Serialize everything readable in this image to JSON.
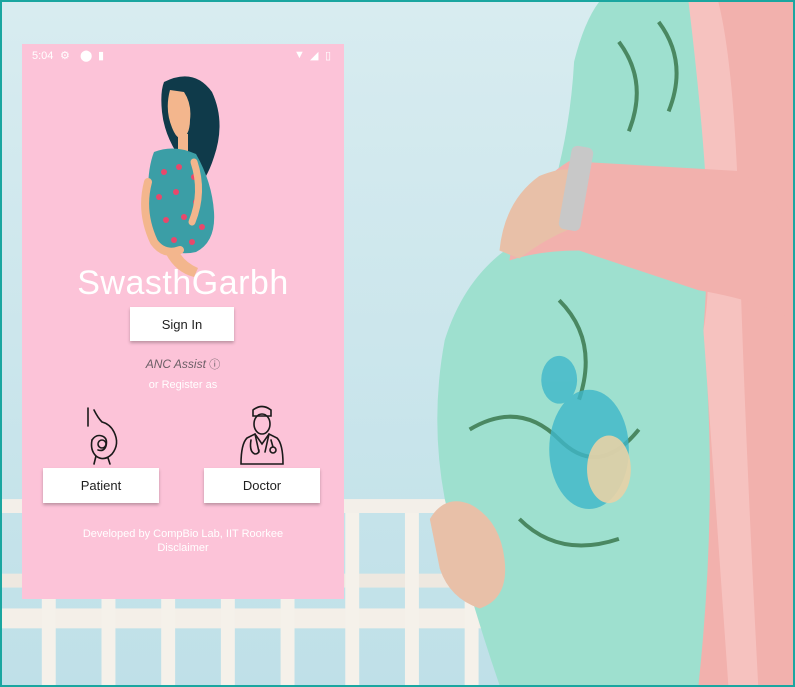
{
  "status_bar": {
    "time": "5:04",
    "left_icons": [
      "gear-icon",
      "shield-icon",
      "sd-card-icon"
    ],
    "right_icons": [
      "wifi-icon",
      "signal-icon",
      "battery-icon"
    ]
  },
  "app": {
    "title": "SwasthGarbh",
    "sign_in_label": "Sign In",
    "anc_assist_label": "ANC Assist",
    "anc_info_glyph": "ⓘ",
    "register_text": "or Register as",
    "patient_label": "Patient",
    "doctor_label": "Doctor",
    "developed_by": "Developed by CompBio Lab, IIT Roorkee",
    "disclaimer": "Disclaimer"
  },
  "colors": {
    "phone_background": "#fcc3d8",
    "frame_border": "#1aa6a0",
    "dress": "#9ee0cf",
    "cardigan": "#f2b1ad"
  }
}
